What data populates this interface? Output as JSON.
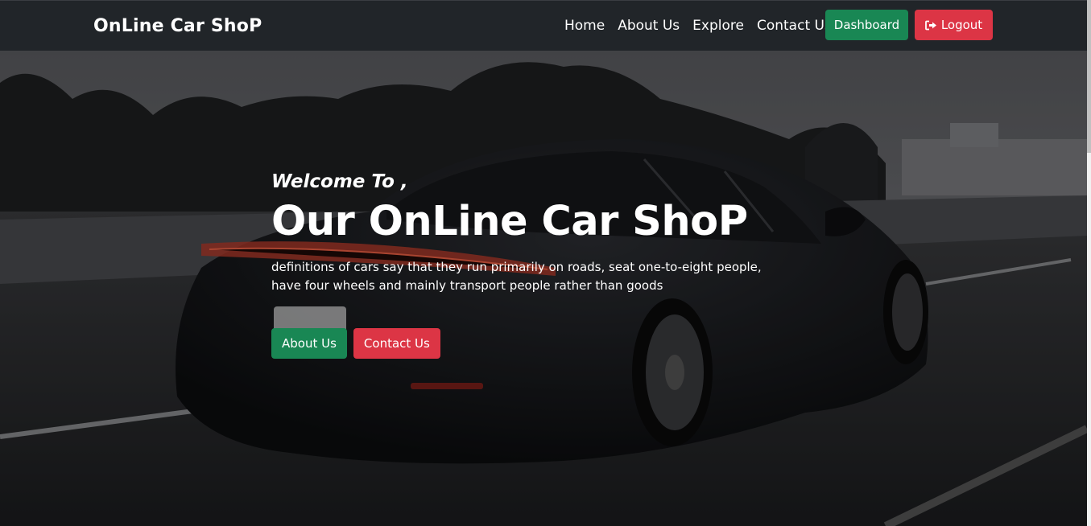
{
  "navbar": {
    "brand": "OnLine Car ShoP",
    "links": [
      "Home",
      "About Us",
      "Explore",
      "Contact Us"
    ],
    "dashboard_label": "Dashboard",
    "logout_label": "Logout",
    "logout_icon": "sign-out-icon"
  },
  "hero": {
    "welcome": "Welcome To ,",
    "title": "Our OnLine Car ShoP",
    "description": "definitions of cars say that they run primarily on roads, seat one-to-eight people, have four wheels and mainly transport people rather than goods",
    "buttons": {
      "about": "About Us",
      "contact": "Contact Us"
    },
    "background": "black sports car on road photo"
  },
  "colors": {
    "navbar": "#212529",
    "success": "#198754",
    "danger": "#dc3545"
  }
}
